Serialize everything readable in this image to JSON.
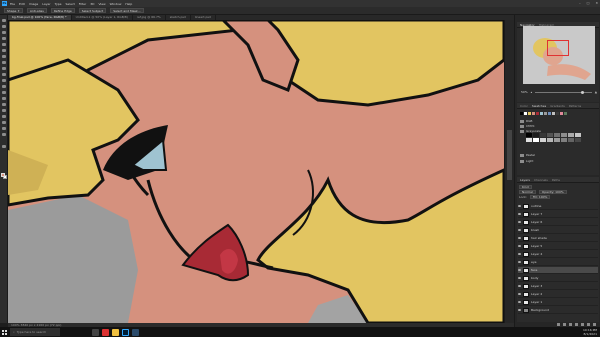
{
  "menu": {
    "logo": "Ps",
    "items": [
      "File",
      "Edit",
      "Image",
      "Layer",
      "Type",
      "Select",
      "Filter",
      "3D",
      "View",
      "Window",
      "Help"
    ]
  },
  "options": {
    "buttons": [
      "Shape ✦",
      "Anti-alias",
      "Refine Edge",
      "Select Subject",
      "Select and Mask..."
    ]
  },
  "doc_tabs": [
    {
      "label": "bg-final.psd @ 100% (face, RGB/8) *",
      "active": true
    },
    {
      "label": "Untitled-1 @ 50% (Layer 1, RGB/8)",
      "active": false
    },
    {
      "label": "ref.jpg @ 66.7%",
      "active": false
    },
    {
      "label": "sketch.psd",
      "active": false
    },
    {
      "label": "lineart.psd",
      "active": false
    }
  ],
  "status": "100%    3840 px x 2160 px (72 ppi)",
  "panels": {
    "navigator_tabs": [
      "Navigator",
      "Histogram"
    ],
    "zoom": "50%",
    "swatches_tabs": [
      "Color",
      "Swatches",
      "Gradients",
      "Patterns"
    ],
    "swatch_folders": [
      "RGB",
      "CMYK",
      "Grayscale",
      "Pastel",
      "Light"
    ],
    "layers_tabs": [
      "Layers",
      "Channels",
      "Paths"
    ],
    "layer_options": [
      "Kind",
      "Normal",
      "Opacity: 100%",
      "Lock:",
      "Fill: 100%"
    ],
    "layers": [
      {
        "name": "outline",
        "selected": false
      },
      {
        "name": "Layer 7",
        "selected": false
      },
      {
        "name": "Layer 6",
        "selected": false
      },
      {
        "name": "blush",
        "selected": false
      },
      {
        "name": "hair shade",
        "selected": false
      },
      {
        "name": "Layer 5",
        "selected": false
      },
      {
        "name": "Layer 4",
        "selected": false
      },
      {
        "name": "eye",
        "selected": false
      },
      {
        "name": "face",
        "selected": true
      },
      {
        "name": "body",
        "selected": false
      },
      {
        "name": "Layer 3",
        "selected": false
      },
      {
        "name": "Layer 2",
        "selected": false
      },
      {
        "name": "Layer 1",
        "selected": false
      },
      {
        "name": "Background",
        "selected": false
      }
    ]
  },
  "taskbar": {
    "search_placeholder": "Type here to search",
    "time": "10:16 PM",
    "date": "8/1/2021"
  },
  "colors": {
    "accent": "#31a8ff",
    "skin": "#d5917e",
    "hair": "#e2c561",
    "lips": "#a82a35",
    "eye": "#9fc3d1"
  }
}
